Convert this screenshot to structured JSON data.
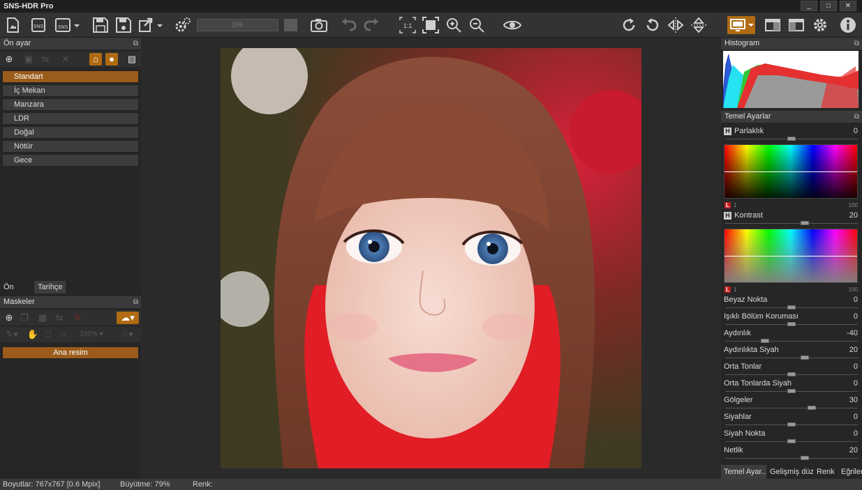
{
  "app": {
    "title": "SNS-HDR Pro"
  },
  "window_controls": [
    "_",
    "□",
    "✕"
  ],
  "toolbar": {
    "progress": "0%"
  },
  "left_panel": {
    "presets_header": "Ön ayar",
    "presets": [
      "Standart",
      "İç Mekan",
      "Manzara",
      "LDR",
      "Doğal",
      "Nötür",
      "Gece"
    ],
    "selected_preset": "Standart",
    "bottom_tabs": [
      "Ön ayar",
      "Tarihçe"
    ],
    "masks_header": "Maskeler",
    "zoom_value": "100%",
    "mask_items": [
      "Ana resim"
    ]
  },
  "right_panel": {
    "histogram_header": "Histogram",
    "basic_header": "Temel Ayarlar",
    "brightness": {
      "label": "Parlaklık",
      "value": "0",
      "level": 0.5
    },
    "curve1_scale": {
      "min": "1",
      "max": "100"
    },
    "contrast": {
      "label": "Kontrast",
      "value": "20",
      "level": 0.6
    },
    "curve2_scale": {
      "min": "1",
      "max": "100"
    },
    "sliders": [
      {
        "label": "Beyaz Nokta",
        "value": "0",
        "level": 0.5
      },
      {
        "label": "Işıklı Bölüm Koruması",
        "value": "0",
        "level": 0.5
      },
      {
        "label": "Aydınlık",
        "value": "-40",
        "level": 0.3
      },
      {
        "label": "Aydınlıkta Siyah",
        "value": "20",
        "level": 0.6
      },
      {
        "label": "Orta Tonlar",
        "value": "0",
        "level": 0.5
      },
      {
        "label": "Orta Tonlarda Siyah",
        "value": "0",
        "level": 0.5
      },
      {
        "label": "Gölgeler",
        "value": "30",
        "level": 0.65
      },
      {
        "label": "Siyahlar",
        "value": "0",
        "level": 0.5
      },
      {
        "label": "Siyah Nokta",
        "value": "0",
        "level": 0.5
      },
      {
        "label": "Netlik",
        "value": "20",
        "level": 0.6
      }
    ],
    "bottom_tabs": [
      "Temel Ayar...",
      "Gelişmiş düz...",
      "Renk",
      "Eğrileri"
    ]
  },
  "status": {
    "dimensions": "Boyutlar: 767x767 [0.6 Mpix]",
    "zoom": "Büyütme: 79%",
    "color": "Renk:"
  },
  "colors": {
    "accent": "#b06a12",
    "selected": "#9b5c1b"
  }
}
